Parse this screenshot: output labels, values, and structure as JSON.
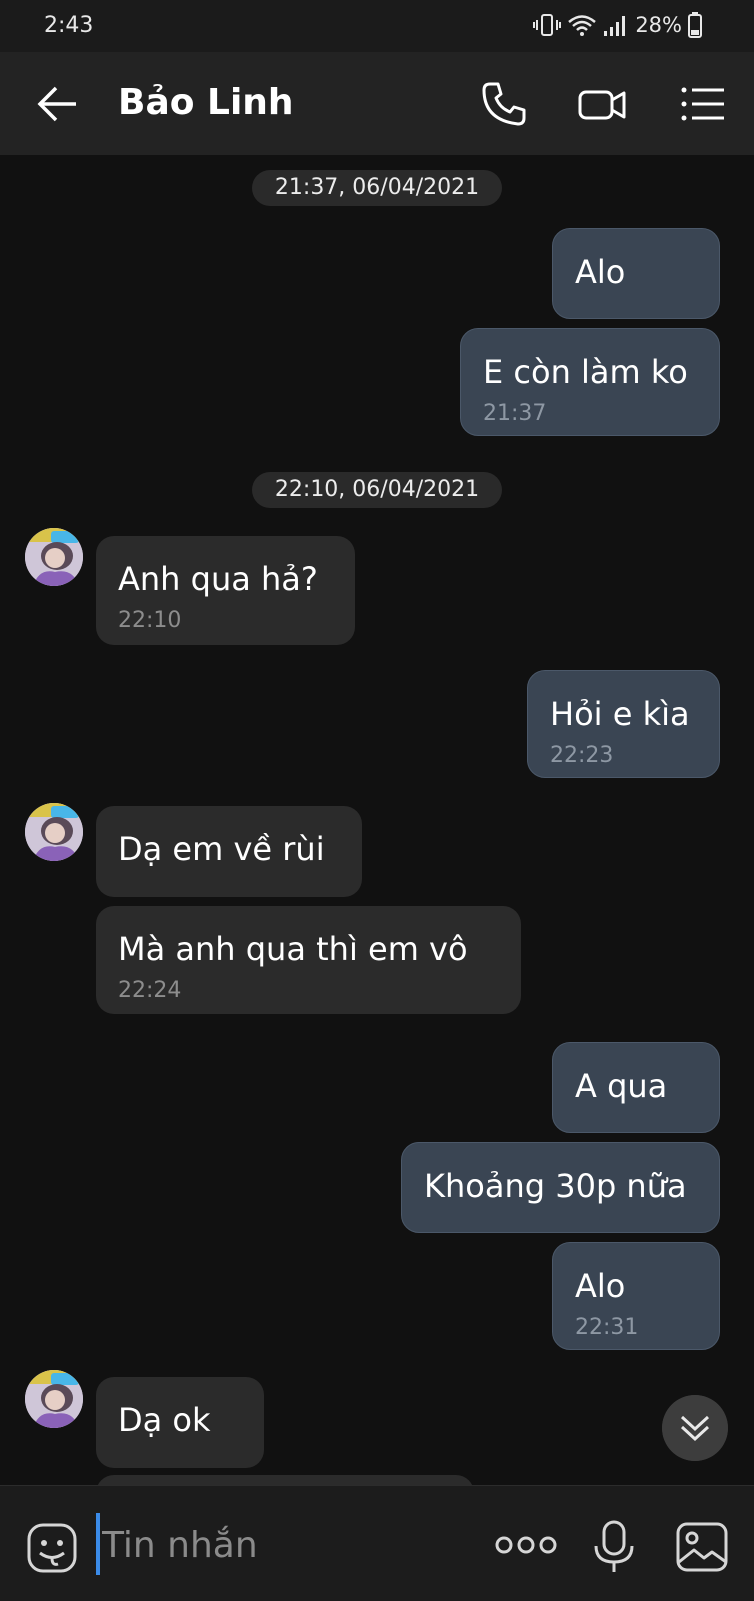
{
  "status_bar": {
    "time": "2:43",
    "battery": "28%"
  },
  "header": {
    "contact_name": "Bảo Linh",
    "back_icon": "arrow-left-icon",
    "call_icon": "phone-icon",
    "video_icon": "video-camera-icon",
    "menu_icon": "list-menu-icon"
  },
  "chat": {
    "date_separators": [
      {
        "label": "21:37, 06/04/2021"
      },
      {
        "label": "22:10, 06/04/2021"
      }
    ],
    "messages": [
      {
        "direction": "out",
        "text": "Alo",
        "time": ""
      },
      {
        "direction": "out",
        "text": "E còn làm ko",
        "time": "21:37"
      },
      {
        "direction": "in",
        "text": "Anh qua hả?",
        "time": "22:10"
      },
      {
        "direction": "out",
        "text": "Hỏi e kìa",
        "time": "22:23"
      },
      {
        "direction": "in",
        "text": "Dạ em về rùi",
        "time": ""
      },
      {
        "direction": "in",
        "text": "Mà anh qua thì em vô",
        "time": "22:24"
      },
      {
        "direction": "out",
        "text": "A qua",
        "time": ""
      },
      {
        "direction": "out",
        "text": "Khoảng 30p nữa",
        "time": ""
      },
      {
        "direction": "out",
        "text": "Alo",
        "time": "22:31"
      },
      {
        "direction": "in",
        "text": "Dạ ok",
        "time": ""
      }
    ]
  },
  "composer": {
    "placeholder": "Tin nhắn",
    "emoji_icon": "emoji-sticker-icon",
    "more_icon": "more-dots-icon",
    "mic_icon": "microphone-icon",
    "image_icon": "image-icon"
  },
  "colors": {
    "background": "#111111",
    "incoming_bubble": "#2b2b2b",
    "outgoing_bubble": "#3a4553",
    "cursor": "#3b8be8"
  }
}
